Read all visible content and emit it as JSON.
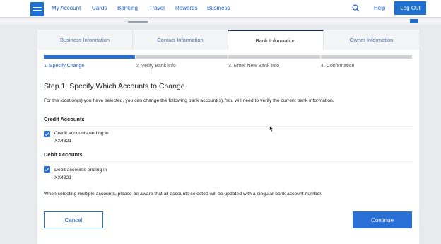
{
  "nav": {
    "links": [
      "My Account",
      "Cards",
      "Banking",
      "Travel",
      "Rewards",
      "Business"
    ],
    "help": "Help",
    "logout": "Log Out",
    "icons": {
      "logo": "american-express-logo",
      "search": "search-icon"
    }
  },
  "tabs": [
    {
      "label": "Business Information",
      "active": false
    },
    {
      "label": "Contact Information",
      "active": false
    },
    {
      "label": "Bank Information",
      "active": true
    },
    {
      "label": "Owner Information",
      "active": false
    }
  ],
  "progress": {
    "steps": [
      "1. Specify Change",
      "2. Verify Bank Info",
      "3. Enter New Bank Info",
      "4. Confirmation"
    ],
    "current_step": 1
  },
  "heading": "Step 1: Specify Which Accounts to Change",
  "intro": "For the location(s) you have selected, you can change the following bank account(s). You will need to verify the current bank information.",
  "credit": {
    "title": "Credit Accounts",
    "label": "Credit accounts ending in",
    "account": "XX4321",
    "checked": true
  },
  "debit": {
    "title": "Debit Accounts",
    "label": "Debit accounts ending in",
    "account": "XX4321",
    "checked": true
  },
  "note": "When selecting multiple accounts, please be aware that all accounts selected will be updated with a singular bank account number.",
  "buttons": {
    "cancel": "Cancel",
    "continue": "Continue"
  },
  "colors": {
    "accent": "#2a6fd6",
    "nav_link": "#1f5fc4",
    "inactive_tab": "#4a6fa5"
  }
}
